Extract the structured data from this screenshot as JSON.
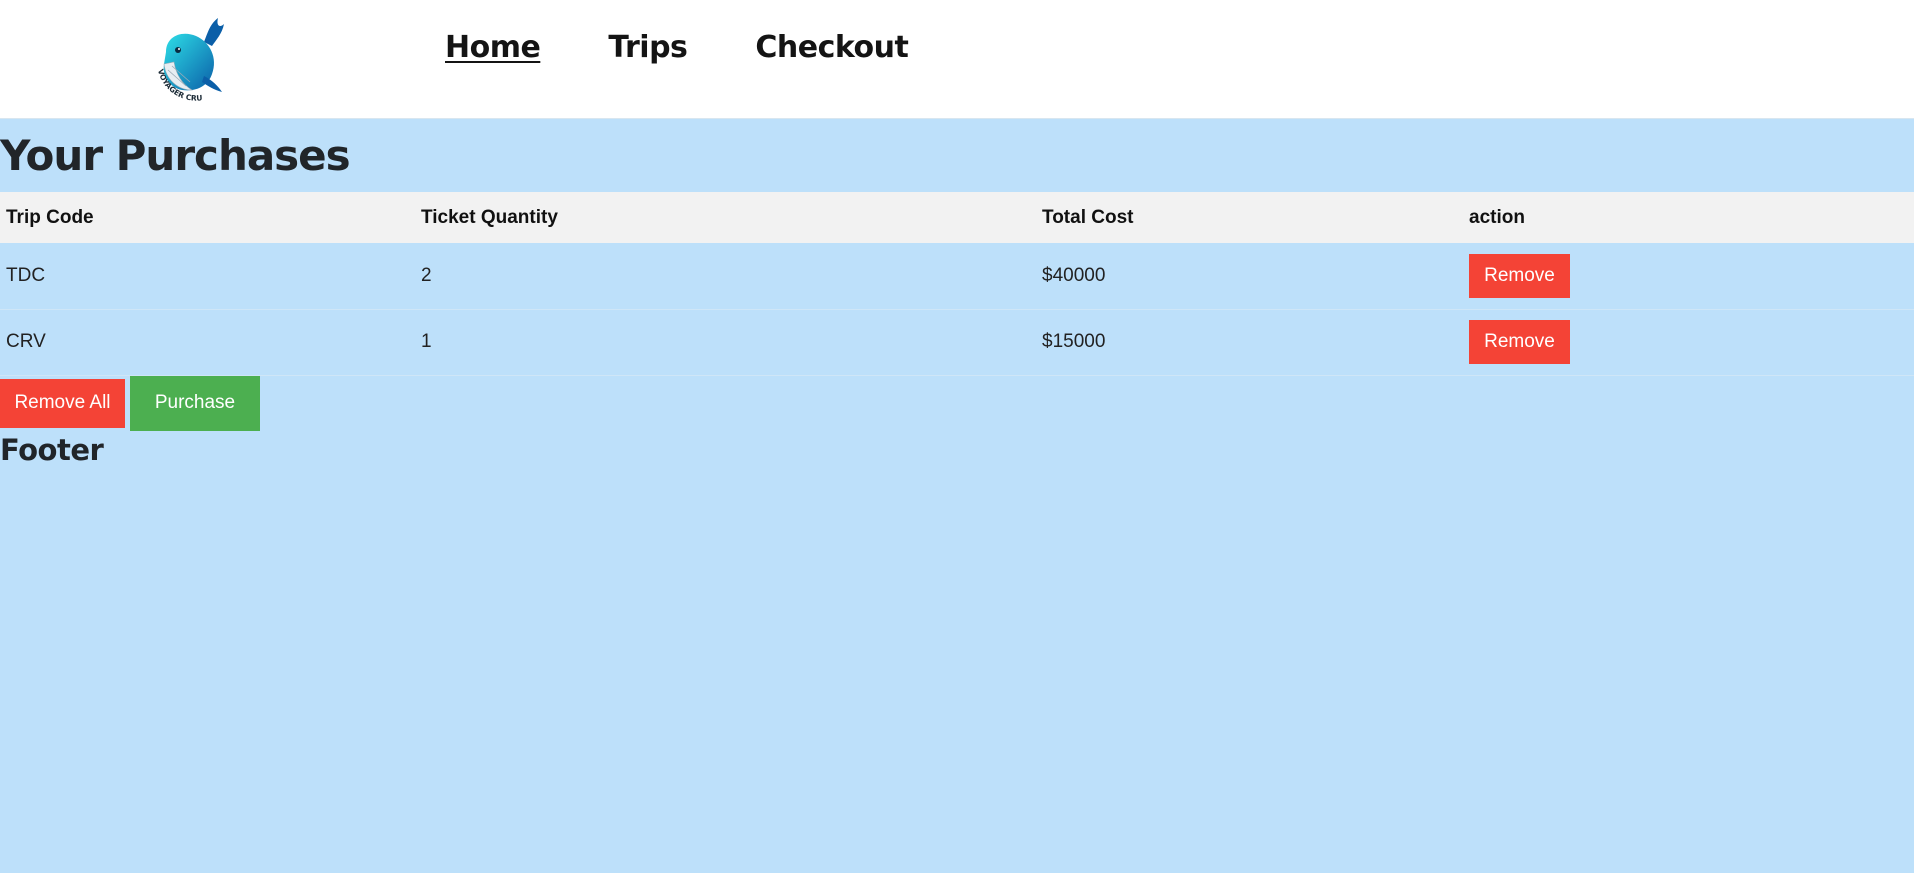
{
  "brand": {
    "logo_text": "VOYAGER CRUISES",
    "logo_icon": "whale-logo"
  },
  "nav": {
    "items": [
      {
        "label": "Home",
        "active": true
      },
      {
        "label": "Trips",
        "active": false
      },
      {
        "label": "Checkout",
        "active": false
      }
    ]
  },
  "main": {
    "title": "Your Purchases",
    "table": {
      "headers": [
        "Trip Code",
        "Ticket Quantity",
        "Total Cost",
        "action"
      ],
      "rows": [
        {
          "trip_code": "TDC",
          "quantity": "2",
          "total": "$40000",
          "action_label": "Remove"
        },
        {
          "trip_code": "CRV",
          "quantity": "1",
          "total": "$15000",
          "action_label": "Remove"
        }
      ]
    },
    "remove_all_label": "Remove All",
    "purchase_label": "Purchase"
  },
  "footer": {
    "text": "Footer"
  },
  "colors": {
    "page_bg": "#bde0fa",
    "danger": "#f44336",
    "success": "#4caf50",
    "header_row_bg": "#f2f2f2"
  }
}
